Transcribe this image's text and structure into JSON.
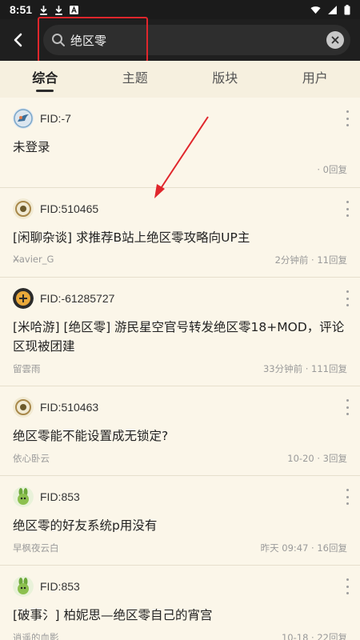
{
  "status_bar": {
    "time": "8:51"
  },
  "search": {
    "query": "绝区零"
  },
  "tabs": [
    {
      "label": "综合"
    },
    {
      "label": "主题"
    },
    {
      "label": "版块"
    },
    {
      "label": "用户"
    }
  ],
  "posts": [
    {
      "fid": "FID:-7",
      "title": "未登录",
      "author": "",
      "meta": "· 0回复"
    },
    {
      "fid": "FID:510465",
      "title": "[闲聊杂谈] 求推荐B站上绝区零攻略向UP主",
      "author": "X̶avier_G",
      "meta": "2分钟前 · 11回复"
    },
    {
      "fid": "FID:-61285727",
      "title": "[米哈游] [绝区零] 游民星空官号转发绝区零18+MOD，评论区现被团建",
      "author": "留雲雨",
      "meta": "33分钟前 · 111回复"
    },
    {
      "fid": "FID:510463",
      "title": "绝区零能不能设置成无锁定?",
      "author": "依心卧云",
      "meta": "10-20 · 3回复"
    },
    {
      "fid": "FID:853",
      "title": "绝区零的好友系统p用没有",
      "author": "早枫夜云白",
      "meta": "昨天 09:47 · 16回复"
    },
    {
      "fid": "FID:853",
      "title": "[破事氵] 柏妮思—绝区零自己的宵宫",
      "author": "逍遥的血影",
      "meta": "10-18 · 22回复"
    }
  ],
  "colors": {
    "highlight": "#e0262c",
    "background": "#f6f0df",
    "appbar": "#1f1f1f"
  }
}
